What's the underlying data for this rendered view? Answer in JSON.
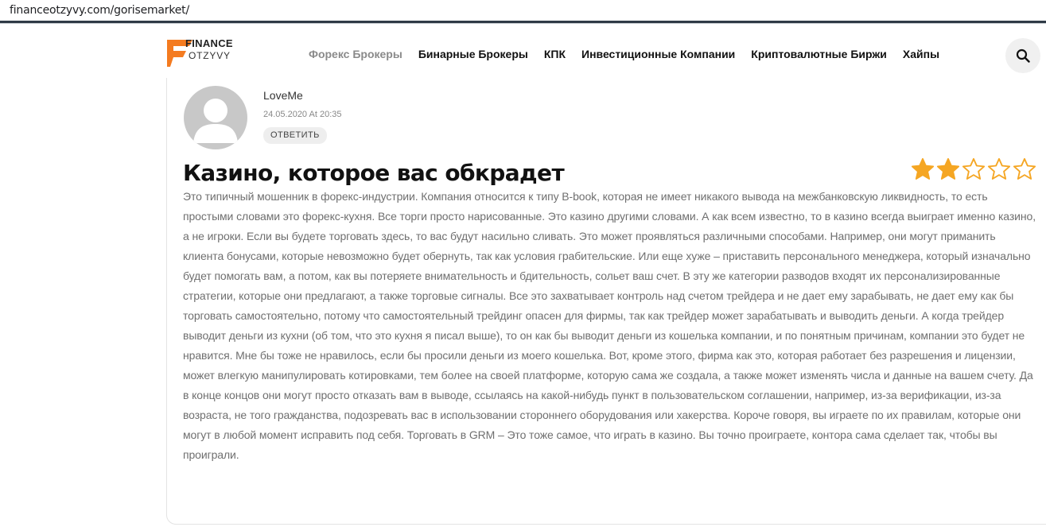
{
  "browser": {
    "url": "financeotzyvy.com/gorisemarket/"
  },
  "logo": {
    "line1": "FINANCE",
    "line2": "OTZYVY",
    "accent": "#f47b20"
  },
  "nav": {
    "items": [
      {
        "label": "Форекс Брокеры",
        "muted": true
      },
      {
        "label": "Бинарные Брокеры"
      },
      {
        "label": "КПК"
      },
      {
        "label": "Инвестиционные Компании"
      },
      {
        "label": "Криптовалютные Биржи"
      },
      {
        "label": "Хайпы"
      }
    ],
    "search_icon": "search-icon"
  },
  "review": {
    "author": "LoveMe",
    "date": "24.05.2020 At 20:35",
    "reply_label": "ОТВЕТИТЬ",
    "title": "Казино, которое вас обкрадет",
    "rating": 2,
    "rating_max": 5,
    "star_color": "#f5a623",
    "text": "Это типичный мошенник в форекс-индустрии. Компания относится к типу B-book, которая не имеет никакого вывода на межбанковскую ликвидность, то есть простыми словами это форекс-кухня. Все торги просто нарисованные. Это казино другими словами. А как всем известно, то в казино всегда выиграет именно казино, а не игроки. Если вы будете торговать здесь, то вас будут насильно сливать. Это может проявляться различными способами. Например, они могут приманить клиента бонусами, которые невозможно будет обернуть, так как условия грабительские. Или еще хуже – приставить персонального менеджера, который изначально будет помогать вам, а потом, как вы потеряете внимательность и бдительность, сольет ваш счет. В эту же категории разводов входят их персонализированные стратегии, которые они предлагают, а также торговые сигналы. Все это захватывает контроль над счетом трейдера и не дает ему зарабывать, не дает ему как бы торговать самостоятельно, потому что самостоятельный трейдинг опасен для фирмы, так как трейдер может зарабатывать и выводить деньги. А когда трейдер выводит деньги из кухни (об том, что это кухня я писал выше), то он как бы выводит деньги из кошелька компании, и по понятным причинам, компании это будет не нравится. Мне бы тоже не нравилось, если бы просили деньги из моего кошелька. Вот, кроме этого, фирма как это, которая работает без разрешения и лицензии, может влегкую манипулировать котировками, тем более на своей платформе, которую сама же создала, а также может изменять числа и данные на вашем счету. Да в конце концов они могут просто отказать вам в выводе, ссылаясь на какой-нибудь пункт в пользовательском соглашении, например, из-за верификации, из-за возраста, не того гражданства, подозревать вас в использовании стороннего оборудования или хакерства. Короче говоря, вы играете по их правилам, которые они могут в любой момент исправить под себя. Торговать в GRM – Это тоже самое, что играть в казино. Вы точно проиграете, контора сама сделает так, чтобы вы проиграли."
  }
}
